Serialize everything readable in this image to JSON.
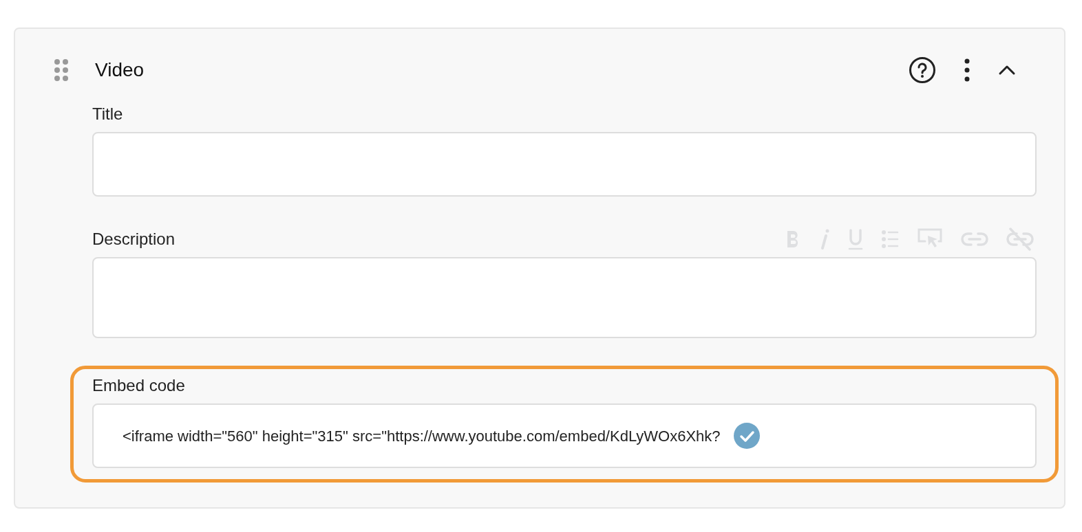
{
  "panel": {
    "title": "Video",
    "expanded": true
  },
  "fields": [
    {
      "kind": "text",
      "label": "Title",
      "highlighted": false
    },
    {
      "kind": "rich",
      "label": "Description",
      "highlighted": false,
      "toolbar_disabled": true
    },
    {
      "kind": "code",
      "label": "Embed code",
      "value": "<iframe width=\"560\" height=\"315\" src=\"https://www.youtube.com/embed/KdLyWOx6Xhk?",
      "valid": true,
      "highlighted": true
    }
  ]
}
